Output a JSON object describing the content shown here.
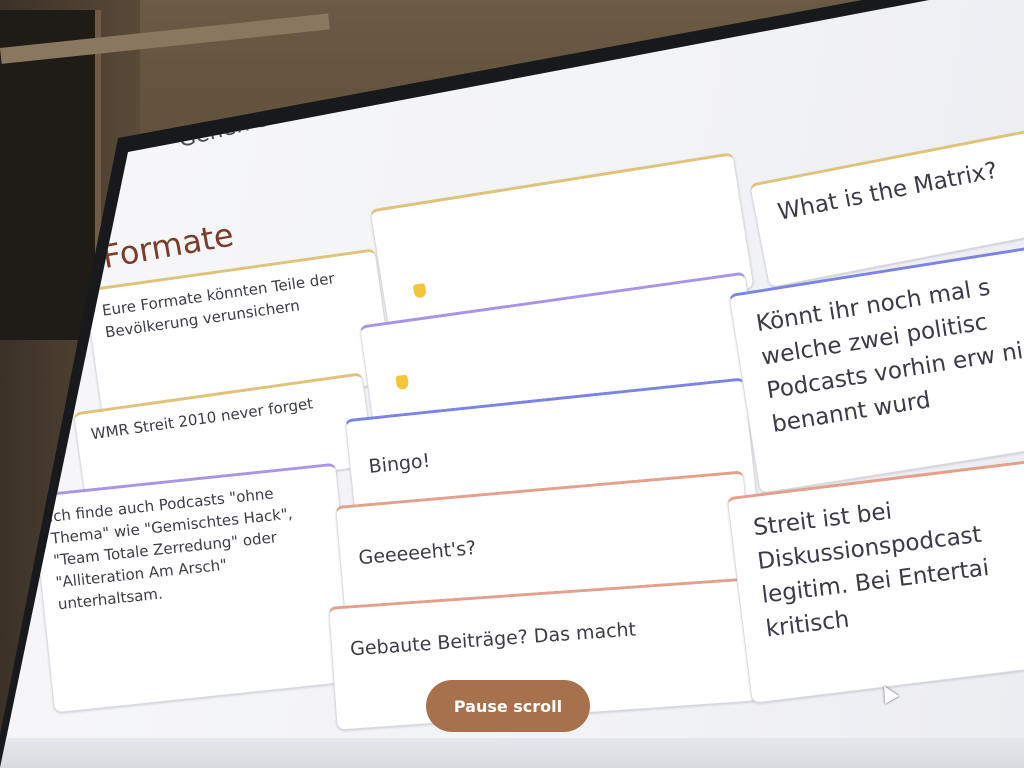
{
  "header": {
    "instruction": "Gehen Sie auf www.menti.com und benutzen"
  },
  "board": {
    "column_title": "Formate",
    "left_column": [
      {
        "text": "Eure Formate könnten Teile der Bevölkerung verunsichern"
      },
      {
        "text": "WMR Streit 2010 never forget"
      },
      {
        "text": "Ich finde auch Podcasts \"ohne Thema\" wie \"Gemischtes Hack\", \"Team Totale Zerredung\" oder \"Alliteration Am Arsch\" unterhaltsam."
      }
    ],
    "middle_column": [
      {
        "text": ""
      },
      {
        "text": ""
      },
      {
        "text": "Bingo!"
      },
      {
        "text": "Geeeeeht's?"
      },
      {
        "text": "Gebaute Beiträge? Das macht"
      }
    ],
    "right_column": [
      {
        "text": "What is the Matrix?"
      },
      {
        "text": "Könnt ihr noch mal s welche zwei politisc Podcasts vorhin erw nicht benannt wurd"
      },
      {
        "text": "Streit ist bei Diskussionspodcast legitim. Bei Entertai kritisch"
      }
    ]
  },
  "controls": {
    "pause_label": "Pause scroll"
  },
  "icons": {
    "rock_emoji": "rock-hand-icon",
    "cursor": "cursor-icon"
  },
  "colors": {
    "accent_button": "#a8714d",
    "title_color": "#7a3d2a",
    "purple_border": "#a895e8",
    "yellow_border": "#e0c37a",
    "red_border": "#e4a08a",
    "blue_border": "#7c82e6"
  }
}
